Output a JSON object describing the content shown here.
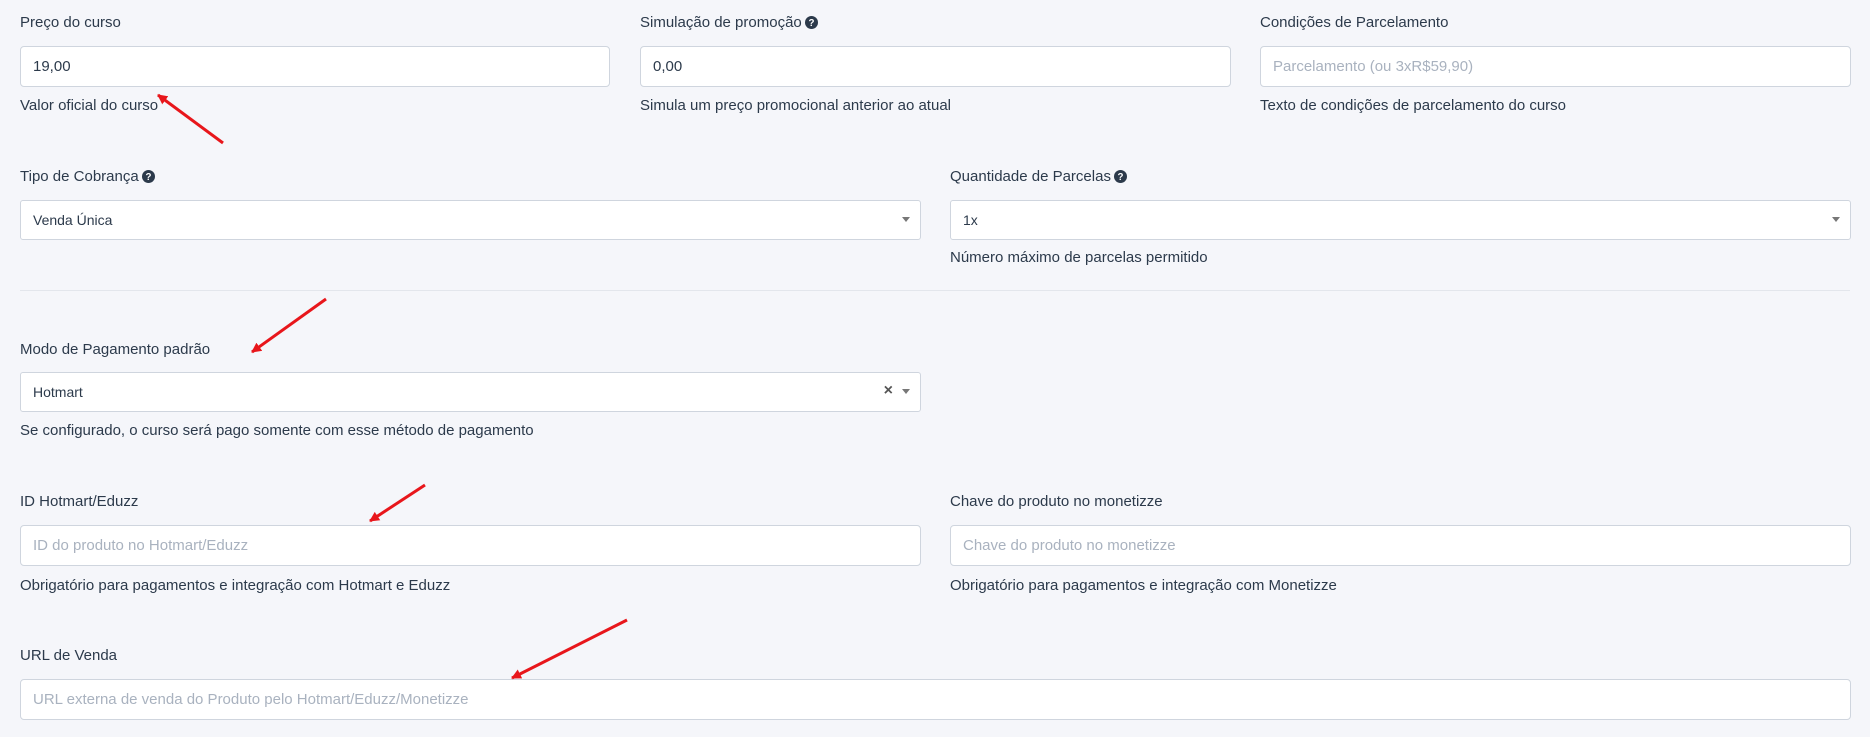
{
  "row1": {
    "price": {
      "label": "Preço do curso",
      "value": "19,00",
      "hint": "Valor oficial do curso"
    },
    "promo": {
      "label": "Simulação de promoção",
      "value": "0,00",
      "hint": "Simula um preço promocional anterior ao atual"
    },
    "installment_conditions": {
      "label": "Condições de Parcelamento",
      "placeholder": "Parcelamento (ou 3xR$59,90)",
      "hint": "Texto de condições de parcelamento do curso"
    }
  },
  "row2": {
    "billing_type": {
      "label": "Tipo de Cobrança",
      "value": "Venda Única"
    },
    "installments": {
      "label": "Quantidade de Parcelas",
      "value": "1x",
      "hint": "Número máximo de parcelas permitido"
    }
  },
  "payment_mode": {
    "label": "Modo de Pagamento padrão",
    "value": "Hotmart",
    "hint": "Se configurado, o curso será pago somente com esse método de pagamento"
  },
  "hotmart_id": {
    "label": "ID Hotmart/Eduzz",
    "placeholder": "ID do produto no Hotmart/Eduzz",
    "hint": "Obrigatório para pagamentos e integração com Hotmart e Eduzz"
  },
  "monetizze_key": {
    "label": "Chave do produto no monetizze",
    "placeholder": "Chave do produto no monetizze",
    "hint": "Obrigatório para pagamentos e integração com Monetizze"
  },
  "sale_url": {
    "label": "URL de Venda",
    "placeholder": "URL externa de venda do Produto pelo Hotmart/Eduzz/Monetizze"
  },
  "icons": {
    "help": "question-circle-icon",
    "caret": "caret-down-icon",
    "clear": "clear-x-icon",
    "annotation": "red-arrow-icon"
  },
  "colors": {
    "annotation_arrow": "#e8161b",
    "text": "#2c3a4b",
    "placeholder": "#a9b2bf",
    "border": "#cfd5de",
    "background": "#f5f6fa"
  }
}
